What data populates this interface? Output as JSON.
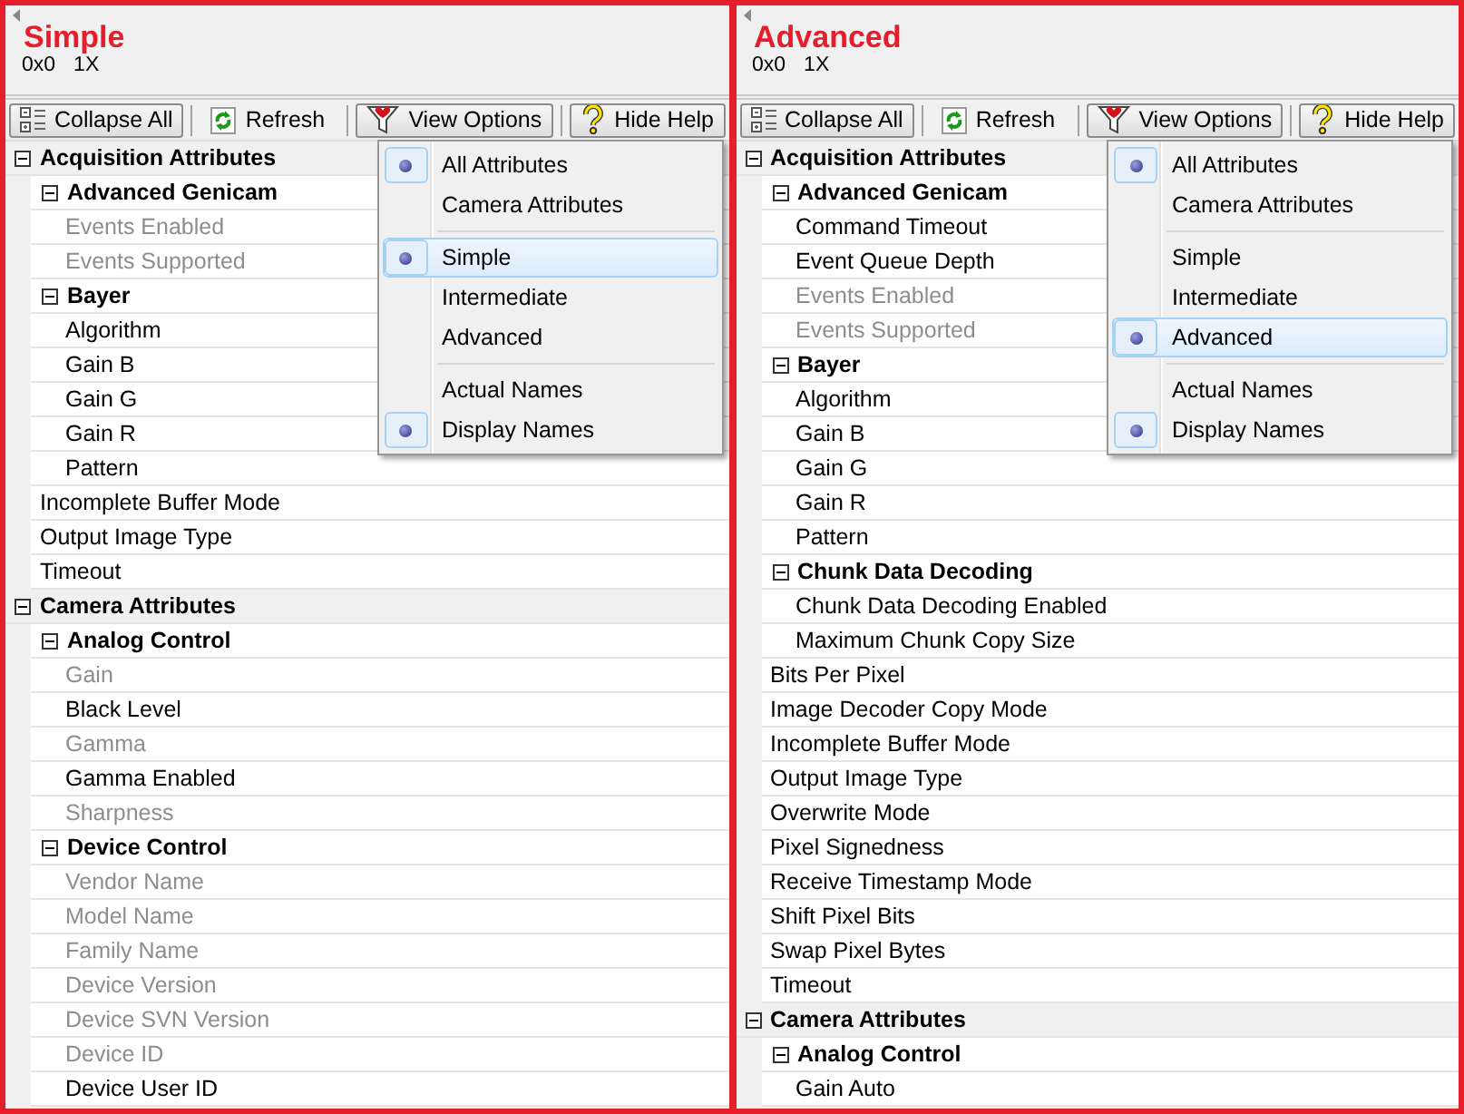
{
  "panels": [
    {
      "title": "Simple",
      "info": [
        "0x0",
        "1X"
      ],
      "toolbar": [
        {
          "label": "Collapse All",
          "kind": "framed"
        },
        {
          "label": "Refresh",
          "kind": "flat"
        },
        {
          "label": "View Options",
          "kind": "framed"
        },
        {
          "label": "Hide Help",
          "kind": "framed"
        }
      ],
      "tree": [
        {
          "label": "Acquisition Attributes",
          "expanded": true,
          "children": [
            {
              "label": "Advanced Genicam",
              "expanded": true,
              "children": [
                {
                  "label": "Events Enabled",
                  "disabled": true
                },
                {
                  "label": "Events Supported",
                  "disabled": true
                }
              ]
            },
            {
              "label": "Bayer",
              "expanded": true,
              "children": [
                {
                  "label": "Algorithm",
                  "disabled": false
                },
                {
                  "label": "Gain B",
                  "disabled": false
                },
                {
                  "label": "Gain G",
                  "disabled": false
                },
                {
                  "label": "Gain R",
                  "disabled": false
                },
                {
                  "label": "Pattern",
                  "disabled": false
                }
              ]
            },
            {
              "label": "Incomplete Buffer Mode",
              "disabled": false
            },
            {
              "label": "Output Image Type",
              "disabled": false
            },
            {
              "label": "Timeout",
              "disabled": false
            }
          ]
        },
        {
          "label": "Camera Attributes",
          "expanded": true,
          "children": [
            {
              "label": "Analog Control",
              "expanded": true,
              "children": [
                {
                  "label": "Gain",
                  "disabled": true
                },
                {
                  "label": "Black Level",
                  "disabled": false
                },
                {
                  "label": "Gamma",
                  "disabled": true
                },
                {
                  "label": "Gamma Enabled",
                  "disabled": false
                },
                {
                  "label": "Sharpness",
                  "disabled": true
                }
              ]
            },
            {
              "label": "Device Control",
              "expanded": true,
              "children": [
                {
                  "label": "Vendor Name",
                  "disabled": true
                },
                {
                  "label": "Model Name",
                  "disabled": true
                },
                {
                  "label": "Family Name",
                  "disabled": true
                },
                {
                  "label": "Device Version",
                  "disabled": true
                },
                {
                  "label": "Device SVN Version",
                  "disabled": true
                },
                {
                  "label": "Device ID",
                  "disabled": true
                },
                {
                  "label": "Device User ID",
                  "disabled": false
                }
              ]
            }
          ]
        }
      ],
      "menu": [
        [
          {
            "label": "All Attributes",
            "selected": true,
            "highlighted": false
          },
          {
            "label": "Camera Attributes",
            "selected": false,
            "highlighted": false
          }
        ],
        [
          {
            "label": "Simple",
            "selected": true,
            "highlighted": true
          },
          {
            "label": "Intermediate",
            "selected": false,
            "highlighted": false
          },
          {
            "label": "Advanced",
            "selected": false,
            "highlighted": false
          }
        ],
        [
          {
            "label": "Actual Names",
            "selected": false,
            "highlighted": false
          },
          {
            "label": "Display Names",
            "selected": true,
            "highlighted": false
          }
        ]
      ]
    },
    {
      "title": "Advanced",
      "info": [
        "0x0",
        "1X"
      ],
      "toolbar": [
        {
          "label": "Collapse All",
          "kind": "framed"
        },
        {
          "label": "Refresh",
          "kind": "flat"
        },
        {
          "label": "View Options",
          "kind": "framed"
        },
        {
          "label": "Hide Help",
          "kind": "framed"
        }
      ],
      "tree": [
        {
          "label": "Acquisition Attributes",
          "expanded": true,
          "children": [
            {
              "label": "Advanced Genicam",
              "expanded": true,
              "children": [
                {
                  "label": "Command Timeout",
                  "disabled": false
                },
                {
                  "label": "Event Queue Depth",
                  "disabled": false
                },
                {
                  "label": "Events Enabled",
                  "disabled": true
                },
                {
                  "label": "Events Supported",
                  "disabled": true
                }
              ]
            },
            {
              "label": "Bayer",
              "expanded": true,
              "children": [
                {
                  "label": "Algorithm",
                  "disabled": false
                },
                {
                  "label": "Gain B",
                  "disabled": false
                },
                {
                  "label": "Gain G",
                  "disabled": false
                },
                {
                  "label": "Gain R",
                  "disabled": false
                },
                {
                  "label": "Pattern",
                  "disabled": false
                }
              ]
            },
            {
              "label": "Chunk Data Decoding",
              "expanded": true,
              "children": [
                {
                  "label": "Chunk Data Decoding Enabled",
                  "disabled": false
                },
                {
                  "label": "Maximum Chunk Copy Size",
                  "disabled": false
                }
              ]
            },
            {
              "label": "Bits Per Pixel",
              "disabled": false
            },
            {
              "label": "Image Decoder Copy Mode",
              "disabled": false
            },
            {
              "label": "Incomplete Buffer Mode",
              "disabled": false
            },
            {
              "label": "Output Image Type",
              "disabled": false
            },
            {
              "label": "Overwrite Mode",
              "disabled": false
            },
            {
              "label": "Pixel Signedness",
              "disabled": false
            },
            {
              "label": "Receive Timestamp Mode",
              "disabled": false
            },
            {
              "label": "Shift Pixel Bits",
              "disabled": false
            },
            {
              "label": "Swap Pixel Bytes",
              "disabled": false
            },
            {
              "label": "Timeout",
              "disabled": false
            }
          ]
        },
        {
          "label": "Camera Attributes",
          "expanded": true,
          "children": [
            {
              "label": "Analog Control",
              "expanded": true,
              "children": [
                {
                  "label": "Gain Auto",
                  "disabled": false
                }
              ]
            }
          ]
        }
      ],
      "menu": [
        [
          {
            "label": "All Attributes",
            "selected": true,
            "highlighted": false
          },
          {
            "label": "Camera Attributes",
            "selected": false,
            "highlighted": false
          }
        ],
        [
          {
            "label": "Simple",
            "selected": false,
            "highlighted": false
          },
          {
            "label": "Intermediate",
            "selected": false,
            "highlighted": false
          },
          {
            "label": "Advanced",
            "selected": true,
            "highlighted": true
          }
        ],
        [
          {
            "label": "Actual Names",
            "selected": false,
            "highlighted": false
          },
          {
            "label": "Display Names",
            "selected": true,
            "highlighted": false
          }
        ]
      ]
    }
  ]
}
